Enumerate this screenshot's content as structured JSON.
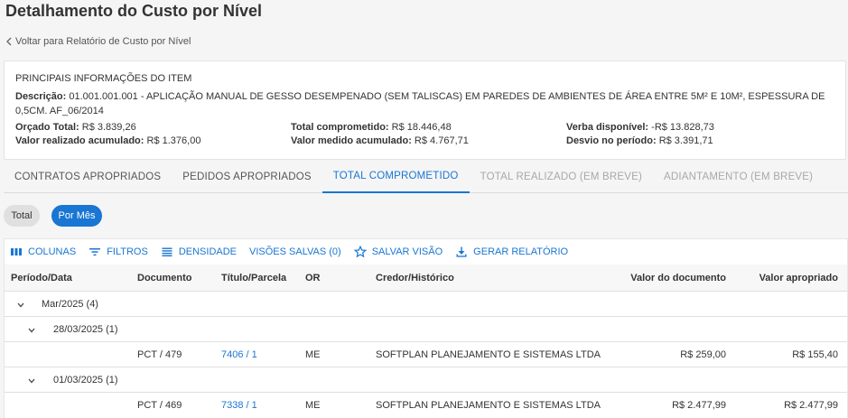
{
  "page": {
    "title": "Detalhamento do Custo por Nível",
    "back_label": "Voltar para Relatório de Custo por Nível"
  },
  "info": {
    "section_title": "PRINCIPAIS INFORMAÇÕES DO ITEM",
    "description_label": "Descrição:",
    "description_value": "01.001.001.001 - APLICAÇÃO MANUAL DE GESSO DESEMPENADO (SEM TALISCAS) EM PAREDES DE AMBIENTES DE ÁREA ENTRE 5M² E 10M², ESPESSURA DE 0,5CM. AF_06/2014",
    "orcado_label": "Orçado Total:",
    "orcado_value": "R$ 3.839,26",
    "realizado_label": "Valor realizado acumulado:",
    "realizado_value": "R$ 1.376,00",
    "comprometido_label": "Total comprometido:",
    "comprometido_value": "R$ 18.446,48",
    "medido_label": "Valor medido acumulado:",
    "medido_value": "R$ 4.767,71",
    "verba_label": "Verba disponível:",
    "verba_value": "-R$ 13.828,73",
    "desvio_label": "Desvio no período:",
    "desvio_value": "R$ 3.391,71"
  },
  "tabs": [
    {
      "label": "CONTRATOS APROPRIADOS",
      "state": "normal"
    },
    {
      "label": "PEDIDOS APROPRIADOS",
      "state": "normal"
    },
    {
      "label": "TOTAL COMPROMETIDO",
      "state": "active"
    },
    {
      "label": "TOTAL REALIZADO (EM BREVE)",
      "state": "disabled"
    },
    {
      "label": "ADIANTAMENTO (EM BREVE)",
      "state": "disabled"
    }
  ],
  "view_toggle": {
    "total_label": "Total",
    "por_mes_label": "Por Mês",
    "selected": "Por Mês"
  },
  "toolbar": {
    "columns_label": "COLUNAS",
    "filters_label": "FILTROS",
    "density_label": "DENSIDADE",
    "saved_views_label": "VISÕES SALVAS (0)",
    "save_view_label": "SALVAR VISÃO",
    "report_label": "GERAR RELATÓRIO"
  },
  "table": {
    "headers": {
      "periodo": "Período/Data",
      "documento": "Documento",
      "titulo": "Título/Parcela",
      "or": "OR",
      "credor": "Credor/Histórico",
      "valor_documento": "Valor do documento",
      "valor_apropriado": "Valor apropriado"
    },
    "group_month": "Mar/2025 (4)",
    "group_day_1": "28/03/2025 (1)",
    "row_1": {
      "documento": "PCT / 479",
      "titulo": "7406 / 1",
      "or": "ME",
      "credor": "SOFTPLAN PLANEJAMENTO E SISTEMAS LTDA",
      "valor_documento": "R$ 259,00",
      "valor_apropriado": "R$ 155,40"
    },
    "group_day_2": "01/03/2025 (1)",
    "row_2": {
      "documento": "PCT / 469",
      "titulo": "7338 / 1",
      "or": "ME",
      "credor": "SOFTPLAN PLANEJAMENTO E SISTEMAS LTDA",
      "valor_documento": "R$ 2.477,99",
      "valor_apropriado": "R$ 2.477,99"
    }
  },
  "colors": {
    "accent": "#1976d2",
    "disabled_tab": "#a8a8a8"
  }
}
